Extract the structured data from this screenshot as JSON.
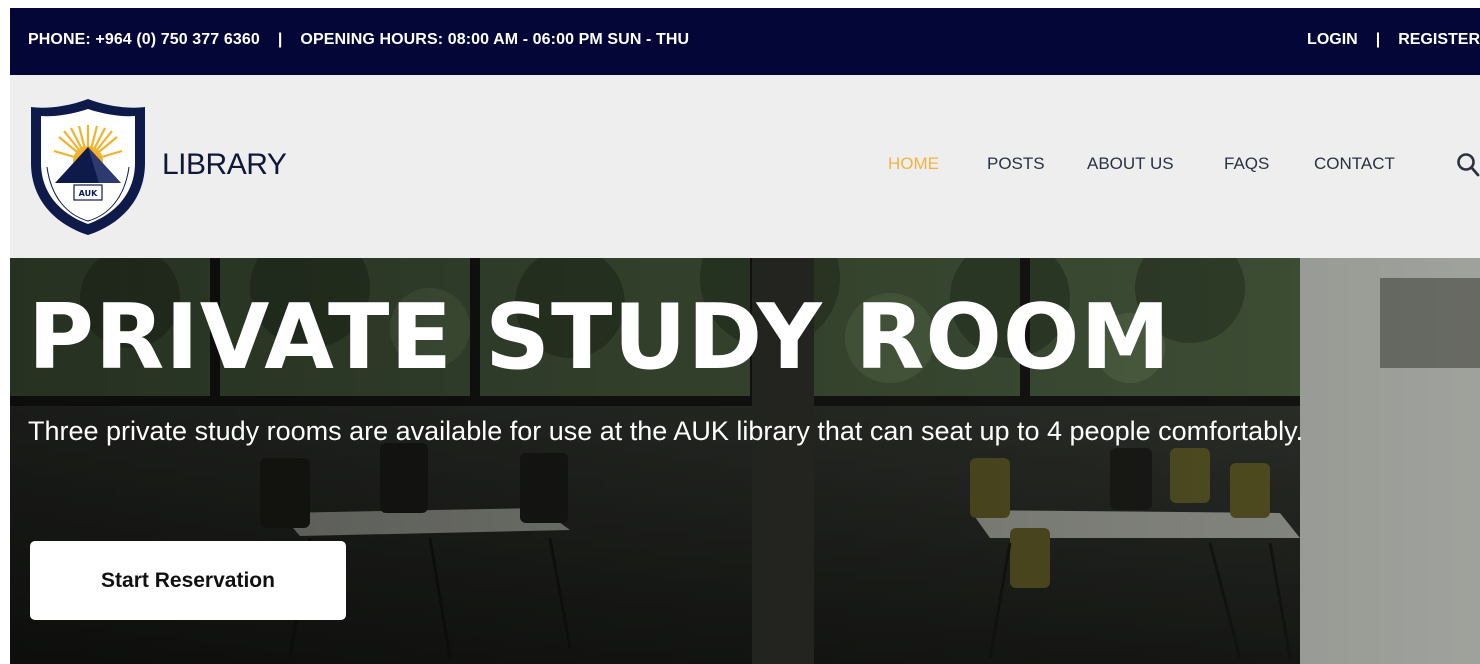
{
  "topbar": {
    "phone": "PHONE: +964 (0) 750 377 6360",
    "separator": "|",
    "hours": "OPENING HOURS: 08:00 AM - 06:00 PM  SUN - THU",
    "login": "LOGIN",
    "register": "REGISTER",
    "bg_color": "#030636"
  },
  "header": {
    "brand": "LIBRARY",
    "logo_icon": "auk-crest-logo",
    "nav": [
      {
        "label": "HOME",
        "active": true
      },
      {
        "label": "POSTS",
        "active": false
      },
      {
        "label": "ABOUT US",
        "active": false
      },
      {
        "label": "FAQS",
        "active": false
      },
      {
        "label": "CONTACT",
        "active": false
      }
    ],
    "search_icon": "search-icon",
    "accent_color": "#f0b344"
  },
  "hero": {
    "title": "PRIVATE STUDY ROOM",
    "description": "Three private study rooms are available for use at the AUK library that can seat up to 4 people comfortably.",
    "button_label": "Start Reservation"
  }
}
